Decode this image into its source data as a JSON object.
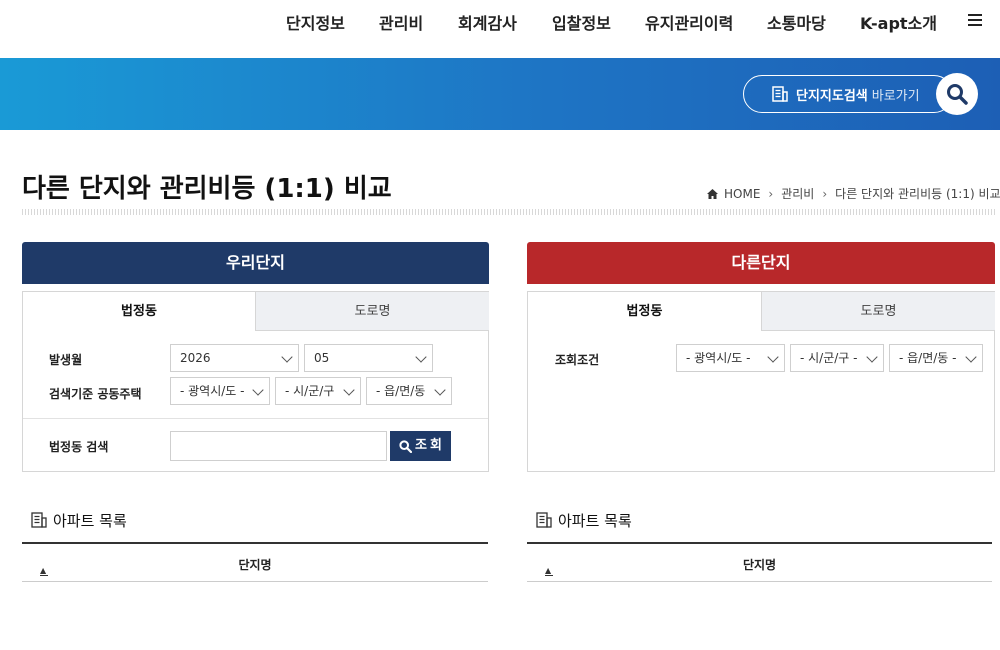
{
  "nav": {
    "items": [
      "단지정보",
      "관리비",
      "회계감사",
      "입찰정보",
      "유지관리이력",
      "소통마당",
      "K-apt소개"
    ],
    "menu_icon": "hamburger-menu-icon"
  },
  "banner": {
    "map_search_bold": "단지지도검색",
    "map_search_sub": "바로가기",
    "search_icon": "search-icon"
  },
  "page": {
    "title": "다른 단지와 관리비등 (1:1) 비교",
    "breadcrumb": [
      "HOME",
      "관리비",
      "다른 단지와 관리비등 (1:1) 비교"
    ]
  },
  "ours": {
    "header": "우리단지",
    "tabs": [
      "법정동",
      "도로명"
    ],
    "active_tab": "법정동",
    "month_label": "발생월",
    "year_value": "2026",
    "month_value": "05",
    "base_label": "검색기준 공동주택",
    "region_selects": [
      "- 광역시/도 -",
      "- 시/군/구",
      "- 읍/면/동"
    ],
    "dong_search_label": "법정동 검색",
    "dong_search_value": "",
    "query_button": "조회",
    "list_title": "아파트 목록",
    "list_column": "단지명",
    "header_color": "#1f3a68"
  },
  "other": {
    "header": "다른단지",
    "tabs": [
      "법정동",
      "도로명"
    ],
    "active_tab": "법정동",
    "condition_label": "조회조건",
    "region_selects": [
      "- 광역시/도 -",
      "- 시/군/구 -",
      "- 읍/면/동 -"
    ],
    "list_title": "아파트 목록",
    "list_column": "단지명",
    "header_color": "#b8282a"
  }
}
